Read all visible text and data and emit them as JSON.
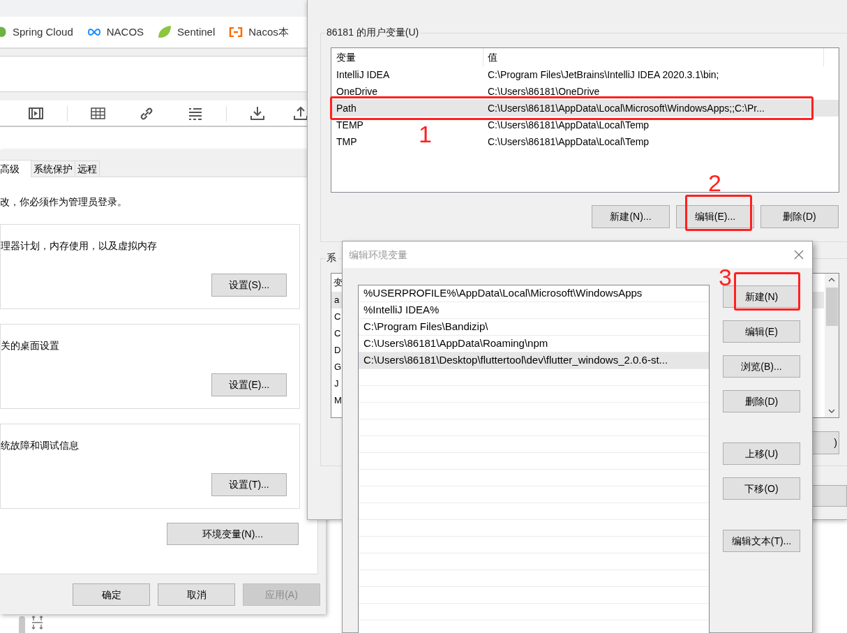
{
  "browser": {
    "bookmarks": [
      {
        "label": "Spring Cloud"
      },
      {
        "label": "NACOS"
      },
      {
        "label": "Sentinel"
      },
      {
        "label": "Nacos本"
      }
    ]
  },
  "system_properties": {
    "tabs": [
      {
        "label": "高级",
        "selected": true
      },
      {
        "label": "系统保护",
        "selected": false
      },
      {
        "label": "远程",
        "selected": false
      }
    ],
    "admin_note": "改，你必须作为管理员登录。",
    "groups": [
      {
        "text": "理器计划，内存使用，以及虚拟内存",
        "button": "设置(S)..."
      },
      {
        "text": "关的桌面设置",
        "button": "设置(E)..."
      },
      {
        "text": "统故障和调试信息",
        "button": "设置(T)..."
      }
    ],
    "env_button": "环境变量(N)...",
    "buttons": [
      {
        "label": "确定",
        "disabled": false
      },
      {
        "label": "取消",
        "disabled": false
      },
      {
        "label": "应用(A)",
        "disabled": true
      }
    ]
  },
  "environment_variables": {
    "user_group": "86181 的用户变量(U)",
    "columns": [
      "变量",
      "值"
    ],
    "rows": [
      {
        "name": "IntelliJ IDEA",
        "value": "C:\\Program Files\\JetBrains\\IntelliJ IDEA 2020.3.1\\bin;",
        "selected": false
      },
      {
        "name": "OneDrive",
        "value": "C:\\Users\\86181\\OneDrive",
        "selected": false
      },
      {
        "name": "Path",
        "value": "C:\\Users\\86181\\AppData\\Local\\Microsoft\\WindowsApps;;C:\\Pr...",
        "selected": true
      },
      {
        "name": "TEMP",
        "value": "C:\\Users\\86181\\AppData\\Local\\Temp",
        "selected": false
      },
      {
        "name": "TMP",
        "value": "C:\\Users\\86181\\AppData\\Local\\Temp",
        "selected": false
      }
    ],
    "user_buttons": [
      "新建(N)...",
      "编辑(E)...",
      "删除(D)"
    ],
    "system_group": "系",
    "system_header": "变",
    "system_rows": [
      {
        "name": "a",
        "selected": true
      },
      {
        "name": "C",
        "selected": false
      },
      {
        "name": "C",
        "selected": false
      },
      {
        "name": "D",
        "selected": false
      },
      {
        "name": "G",
        "selected": false
      },
      {
        "name": "J",
        "selected": false
      },
      {
        "name": "M",
        "selected": false
      }
    ],
    "system_button": ")"
  },
  "edit_dialog": {
    "title": "编辑环境变量",
    "entries": [
      {
        "text": "%USERPROFILE%\\AppData\\Local\\Microsoft\\WindowsApps",
        "selected": false
      },
      {
        "text": "%IntelliJ IDEA%",
        "selected": false
      },
      {
        "text": "C:\\Program Files\\Bandizip\\",
        "selected": false
      },
      {
        "text": "C:\\Users\\86181\\AppData\\Roaming\\npm",
        "selected": false
      },
      {
        "text": "C:\\Users\\86181\\Desktop\\fluttertool\\dev\\flutter_windows_2.0.6-st...",
        "selected": true
      }
    ],
    "buttons": [
      "新建(N)",
      "编辑(E)",
      "浏览(B)...",
      "删除(D)",
      "上移(U)",
      "下移(O)",
      "编辑文本(T)..."
    ]
  },
  "annotations": [
    {
      "label": "1"
    },
    {
      "label": "2"
    },
    {
      "label": "3"
    }
  ]
}
